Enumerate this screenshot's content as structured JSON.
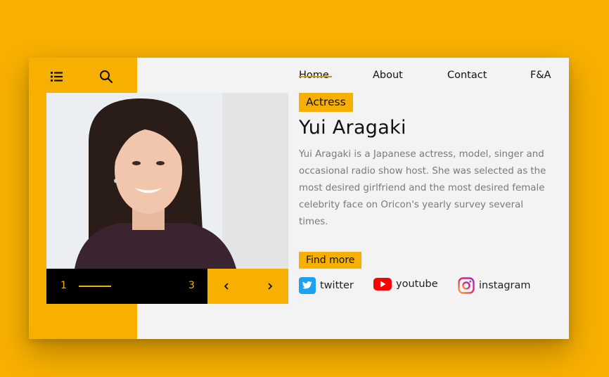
{
  "sidebar": {
    "menu_icon": "list-menu-icon",
    "search_icon": "search-icon"
  },
  "nav": {
    "home": "Home",
    "about": "About",
    "contact": "Contact",
    "fa": "F&A"
  },
  "profile": {
    "tag": "Actress",
    "name": "Yui Aragaki",
    "description": "Yui Aragaki is a Japanese actress, model, singer and occasional radio show host. She was selected as the most desired girlfriend and the most desired female celebrity face on Oricon's yearly survey several times.",
    "cta": "Find more"
  },
  "slider": {
    "current": "1",
    "total": "3",
    "prev_icon": "chevron-left-icon",
    "next_icon": "chevron-right-icon"
  },
  "social": [
    {
      "label": "twitter",
      "icon": "twitter-icon",
      "color": "#1da1f2"
    },
    {
      "label": "youtube",
      "icon": "youtube-icon",
      "color": "#ff0000"
    },
    {
      "label": "instagram",
      "icon": "instagram-icon",
      "color": "#c13584"
    }
  ],
  "colors": {
    "accent": "#f7b000",
    "card": "#f4f3f3",
    "dark": "#000000"
  }
}
